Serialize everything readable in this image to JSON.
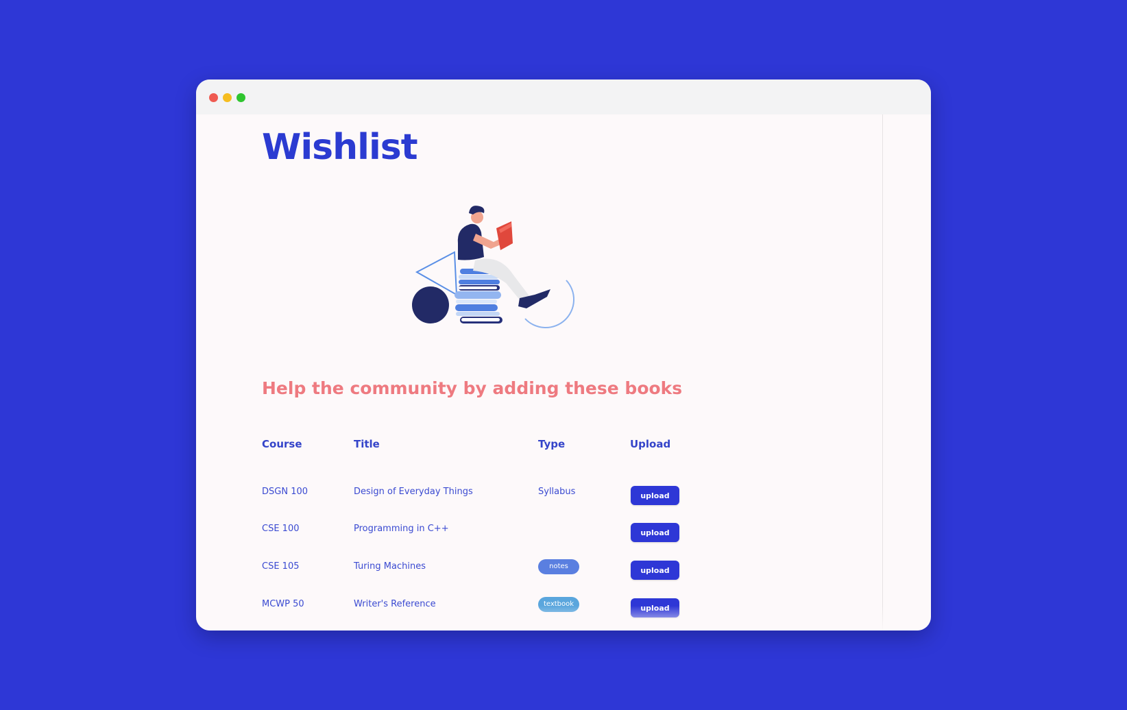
{
  "page": {
    "title": "Wishlist",
    "subtitle": "Help the community by adding these books"
  },
  "illustration": {
    "icon": "person-reading-books-illustration"
  },
  "table": {
    "headers": {
      "course": "Course",
      "title": "Title",
      "type": "Type",
      "upload": "Upload"
    },
    "rows": [
      {
        "course": "DSGN 100",
        "title": "Design of Everyday Things",
        "type_text": "Syllabus",
        "badge": "",
        "upload": "upload"
      },
      {
        "course": "CSE 100",
        "title": "Programming in C++",
        "type_text": "",
        "badge": "",
        "upload": "upload"
      },
      {
        "course": "CSE 105",
        "title": "Turing Machines",
        "type_text": "",
        "badge": "notes",
        "upload": "upload"
      },
      {
        "course": "MCWP 50",
        "title": "Writer's Reference",
        "type_text": "",
        "badge": "textbook",
        "upload": "upload"
      }
    ]
  },
  "colors": {
    "background": "#2e37d6",
    "title": "#2b3bd1",
    "subtitle": "#ee7a80",
    "button": "#2e37d6",
    "badge_notes": "#5a7fe0",
    "badge_textbook": "#5aa6dd"
  }
}
